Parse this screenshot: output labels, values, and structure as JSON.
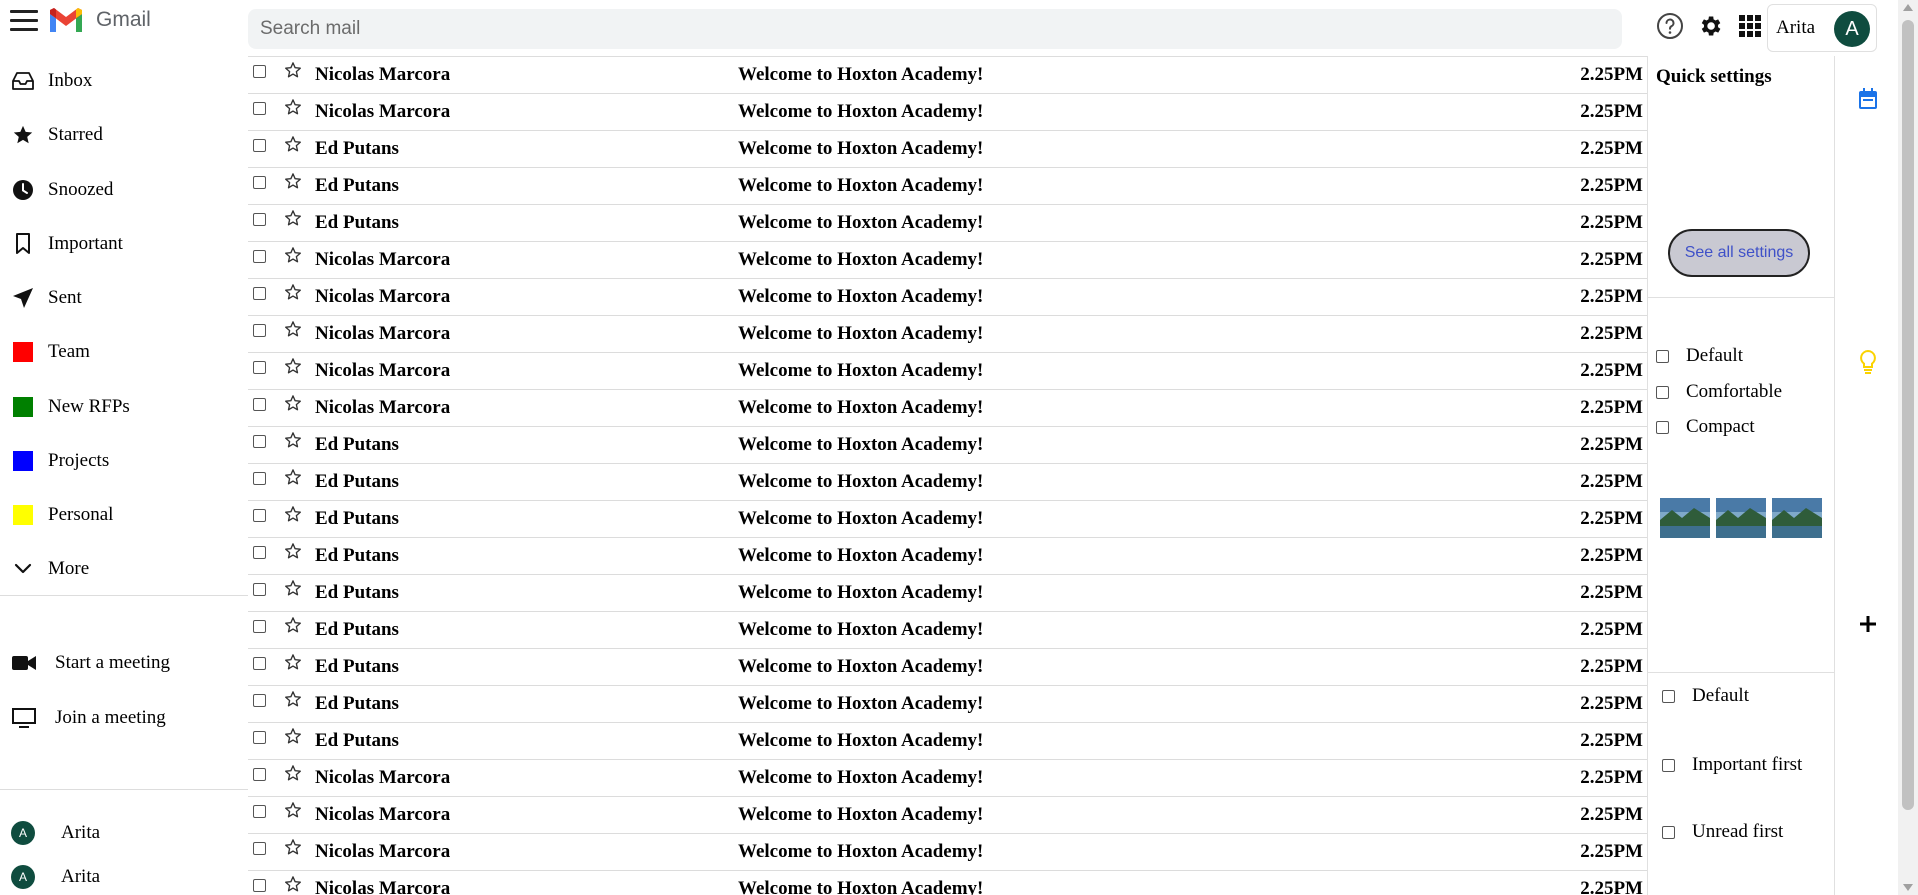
{
  "app": {
    "name": "Gmail",
    "menu_icon": "hamburger-menu-icon",
    "logo_icon": "gmail-logo-icon"
  },
  "search": {
    "placeholder": "Search mail",
    "value": ""
  },
  "header": {
    "icons": [
      "help-icon",
      "settings-gear-icon",
      "apps-grid-icon"
    ],
    "account_name": "Arita",
    "avatar_initial": "A",
    "avatar_color": "#0f4c3f"
  },
  "sidebar": {
    "items": [
      {
        "label": "Inbox",
        "icon": "inbox-icon"
      },
      {
        "label": "Starred",
        "icon": "star-icon"
      },
      {
        "label": "Snoozed",
        "icon": "clock-icon"
      },
      {
        "label": "Important",
        "icon": "bookmark-icon"
      },
      {
        "label": "Sent",
        "icon": "send-icon"
      },
      {
        "label": "Team",
        "icon": "label-swatch",
        "color": "#ff0000"
      },
      {
        "label": "New RFPs",
        "icon": "label-swatch",
        "color": "#008000"
      },
      {
        "label": "Projects",
        "icon": "label-swatch",
        "color": "#0000ff"
      },
      {
        "label": "Personal",
        "icon": "label-swatch",
        "color": "#ffff00"
      },
      {
        "label": "More",
        "icon": "chevron-down-icon"
      }
    ],
    "meet": [
      {
        "label": "Start a meeting",
        "icon": "video-camera-icon"
      },
      {
        "label": "Join a meeting",
        "icon": "monitor-icon"
      }
    ],
    "chat_users": [
      {
        "name": "Arita",
        "initial": "A"
      },
      {
        "name": "Arita",
        "initial": "A"
      }
    ]
  },
  "emails": [
    {
      "sender": "Nicolas Marcora",
      "subject": "Welcome to Hoxton Academy!",
      "time": "2.25PM"
    },
    {
      "sender": "Nicolas Marcora",
      "subject": "Welcome to Hoxton Academy!",
      "time": "2.25PM"
    },
    {
      "sender": "Ed Putans",
      "subject": "Welcome to Hoxton Academy!",
      "time": "2.25PM"
    },
    {
      "sender": "Ed Putans",
      "subject": "Welcome to Hoxton Academy!",
      "time": "2.25PM"
    },
    {
      "sender": "Ed Putans",
      "subject": "Welcome to Hoxton Academy!",
      "time": "2.25PM"
    },
    {
      "sender": "Nicolas Marcora",
      "subject": "Welcome to Hoxton Academy!",
      "time": "2.25PM"
    },
    {
      "sender": "Nicolas Marcora",
      "subject": "Welcome to Hoxton Academy!",
      "time": "2.25PM"
    },
    {
      "sender": "Nicolas Marcora",
      "subject": "Welcome to Hoxton Academy!",
      "time": "2.25PM"
    },
    {
      "sender": "Nicolas Marcora",
      "subject": "Welcome to Hoxton Academy!",
      "time": "2.25PM"
    },
    {
      "sender": "Nicolas Marcora",
      "subject": "Welcome to Hoxton Academy!",
      "time": "2.25PM"
    },
    {
      "sender": "Ed Putans",
      "subject": "Welcome to Hoxton Academy!",
      "time": "2.25PM"
    },
    {
      "sender": "Ed Putans",
      "subject": "Welcome to Hoxton Academy!",
      "time": "2.25PM"
    },
    {
      "sender": "Ed Putans",
      "subject": "Welcome to Hoxton Academy!",
      "time": "2.25PM"
    },
    {
      "sender": "Ed Putans",
      "subject": "Welcome to Hoxton Academy!",
      "time": "2.25PM"
    },
    {
      "sender": "Ed Putans",
      "subject": "Welcome to Hoxton Academy!",
      "time": "2.25PM"
    },
    {
      "sender": "Ed Putans",
      "subject": "Welcome to Hoxton Academy!",
      "time": "2.25PM"
    },
    {
      "sender": "Ed Putans",
      "subject": "Welcome to Hoxton Academy!",
      "time": "2.25PM"
    },
    {
      "sender": "Ed Putans",
      "subject": "Welcome to Hoxton Academy!",
      "time": "2.25PM"
    },
    {
      "sender": "Ed Putans",
      "subject": "Welcome to Hoxton Academy!",
      "time": "2.25PM"
    },
    {
      "sender": "Nicolas Marcora",
      "subject": "Welcome to Hoxton Academy!",
      "time": "2.25PM"
    },
    {
      "sender": "Nicolas Marcora",
      "subject": "Welcome to Hoxton Academy!",
      "time": "2.25PM"
    },
    {
      "sender": "Nicolas Marcora",
      "subject": "Welcome to Hoxton Academy!",
      "time": "2.25PM"
    },
    {
      "sender": "Nicolas Marcora",
      "subject": "Welcome to Hoxton Academy!",
      "time": "2.25PM"
    }
  ],
  "quick_settings": {
    "title": "Quick settings",
    "see_all_label": "See all settings",
    "density_options": [
      "Default",
      "Comfortable",
      "Compact"
    ],
    "sort_options": [
      "Default",
      "Important first",
      "Unread first"
    ],
    "theme_count": 3
  },
  "right_rail": {
    "icons": [
      {
        "name": "calendar-icon",
        "color": "#1a73e8"
      },
      {
        "name": "keep-bulb-icon",
        "color": "#fbd300"
      },
      {
        "name": "add-icon",
        "color": "#000000"
      }
    ]
  }
}
